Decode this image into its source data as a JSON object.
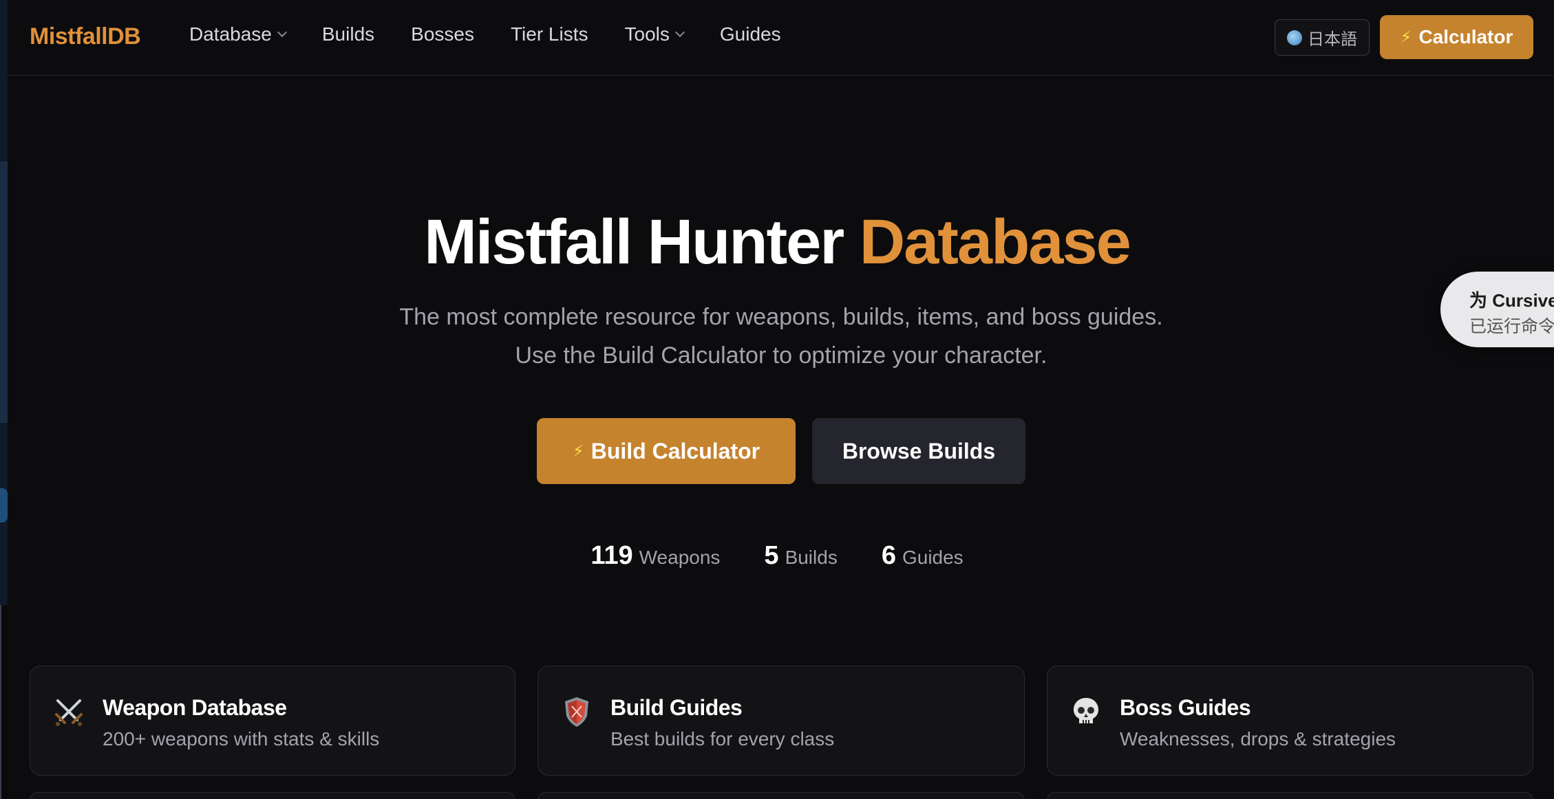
{
  "header": {
    "logo": "MistfallDB",
    "nav": [
      {
        "label": "Database",
        "dropdown": true
      },
      {
        "label": "Builds",
        "dropdown": false
      },
      {
        "label": "Bosses",
        "dropdown": false
      },
      {
        "label": "Tier Lists",
        "dropdown": false
      },
      {
        "label": "Tools",
        "dropdown": true
      },
      {
        "label": "Guides",
        "dropdown": false
      }
    ],
    "language": "日本語",
    "calculator": "Calculator"
  },
  "hero": {
    "title_main": "Mistfall Hunter ",
    "title_accent": "Database",
    "subtitle": "The most complete resource for weapons, builds, items, and boss guides. Use the Build Calculator to optimize your character.",
    "primary_button": "Build Calculator",
    "secondary_button": "Browse Builds"
  },
  "stats": [
    {
      "value": "119",
      "label": "Weapons"
    },
    {
      "value": "5",
      "label": "Builds"
    },
    {
      "value": "6",
      "label": "Guides"
    }
  ],
  "cards": [
    {
      "icon": "crossed-swords-icon",
      "title": "Weapon Database",
      "desc": "200+ weapons with stats & skills"
    },
    {
      "icon": "shield-icon",
      "title": "Build Guides",
      "desc": "Best builds for every class"
    },
    {
      "icon": "skull-icon",
      "title": "Boss Guides",
      "desc": "Weaknesses, drops & strategies"
    }
  ],
  "toast": {
    "title": "为 Cursive",
    "subtitle": "已运行命令"
  },
  "colors": {
    "accent": "#e0913a",
    "button": "#c5832e",
    "background": "#0c0c0e",
    "card": "#131316"
  }
}
